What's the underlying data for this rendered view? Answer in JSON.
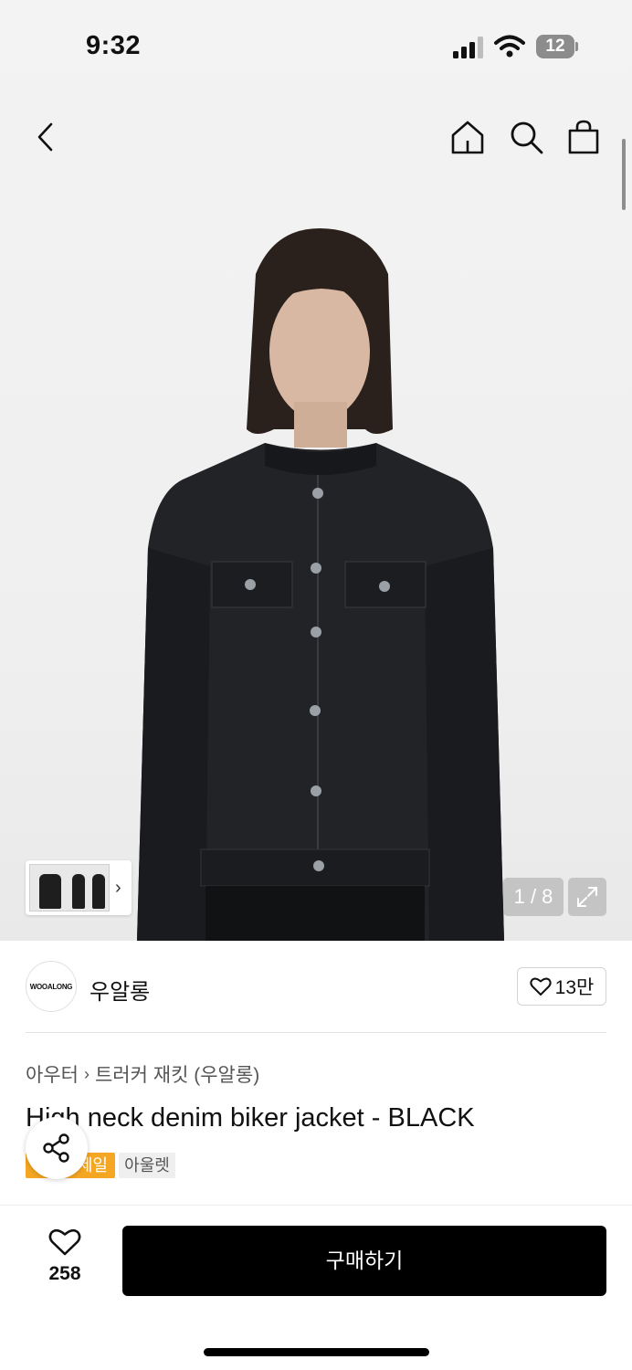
{
  "status_bar": {
    "time": "9:32",
    "battery": "12"
  },
  "nav": {
    "back_icon": "chevron-left-icon",
    "home_icon": "home-icon",
    "search_icon": "search-icon",
    "bag_icon": "shopping-bag-icon"
  },
  "gallery": {
    "counter": "1 / 8",
    "expand_icon": "expand-icon",
    "thumb_chevron": "›"
  },
  "brand": {
    "logo_text": "WOOALONG",
    "name": "우알롱",
    "likes": "13만"
  },
  "breadcrumb": {
    "category": "아우터",
    "separator": "›",
    "subcategory": "트러커 재킷 (우알롱)"
  },
  "product": {
    "title": "High neck denim biker jacket - BLACK"
  },
  "tags": {
    "sale": "세일",
    "outlet": "아울렛"
  },
  "bottom_bar": {
    "wishlist_count": "258",
    "buy_label": "구매하기"
  },
  "colors": {
    "accent": "#f5a623",
    "buy_button": "#000000"
  }
}
